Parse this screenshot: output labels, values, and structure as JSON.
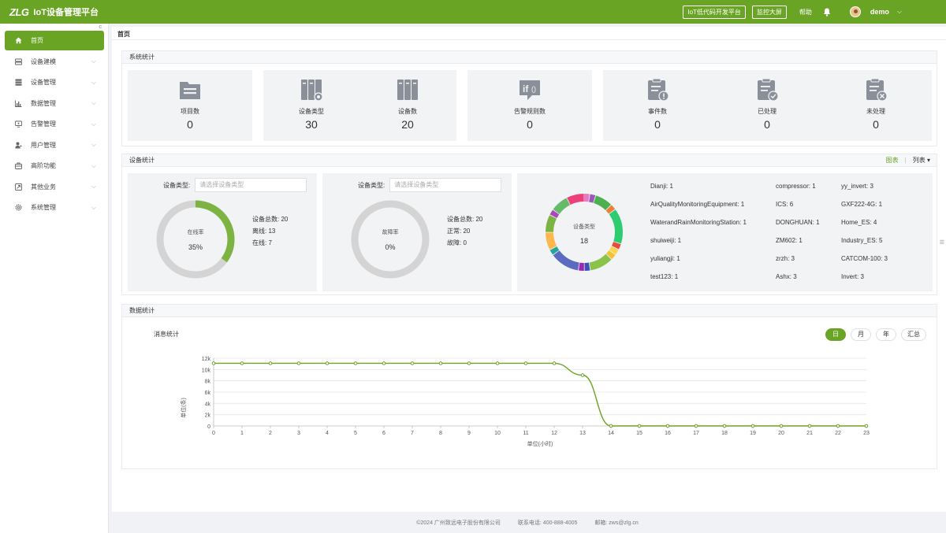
{
  "header": {
    "logo": "ZLG",
    "title": "IoT设备管理平台",
    "lowcode_label": "IoT低代码开发平台",
    "monitor_label": "监控大屏",
    "help_label": "帮助",
    "username": "demo",
    "accent": "#6aa424"
  },
  "sidebar": {
    "items": [
      {
        "label": "首页",
        "icon": "home-icon"
      },
      {
        "label": "设备建模",
        "icon": "model-icon"
      },
      {
        "label": "设备管理",
        "icon": "device-icon"
      },
      {
        "label": "数据管理",
        "icon": "bar-chart-icon"
      },
      {
        "label": "告警管理",
        "icon": "alarm-icon"
      },
      {
        "label": "用户管理",
        "icon": "user-icon"
      },
      {
        "label": "高阶功能",
        "icon": "toolbox-icon"
      },
      {
        "label": "其他业务",
        "icon": "link-icon"
      },
      {
        "label": "系统管理",
        "icon": "gear-icon"
      }
    ]
  },
  "page": {
    "title": "首页"
  },
  "system_stats": {
    "title": "系统统计",
    "items": [
      {
        "label": "项目数",
        "value": "0",
        "icon": "project-icon"
      },
      {
        "label": "设备类型",
        "value": "30",
        "icon": "device-type-icon"
      },
      {
        "label": "设备数",
        "value": "20",
        "icon": "devices-icon"
      },
      {
        "label": "告警规则数",
        "value": "0",
        "icon": "rule-icon"
      },
      {
        "label": "事件数",
        "value": "0",
        "icon": "event-icon"
      },
      {
        "label": "已处理",
        "value": "0",
        "icon": "handled-icon"
      },
      {
        "label": "未处理",
        "value": "0",
        "icon": "unhandled-icon"
      }
    ]
  },
  "device_stats": {
    "title": "设备统计",
    "view_chart": "图表",
    "view_list": "列表",
    "online_panel": {
      "filter_label": "设备类型:",
      "placeholder": "请选择设备类型",
      "gauge_label": "在线率",
      "gauge_value": "35%",
      "rate": 0.35,
      "total": "设备总数: 20",
      "offline": "离线: 13",
      "online": "在线: 7"
    },
    "fault_panel": {
      "filter_label": "设备类型:",
      "placeholder": "请选择设备类型",
      "gauge_label": "故障率",
      "gauge_value": "0%",
      "rate": 0,
      "total": "设备总数: 20",
      "normal": "正常: 20",
      "fault": "故障: 0"
    },
    "type_panel": {
      "center_label": "设备类型",
      "center_value": "18",
      "legend": [
        "Dianji:  1",
        "compressor:  1",
        "yy_invert:  3",
        "AirQualityMonitoringEquipment:  1",
        "ICS:  6",
        "GXF222-4G:  1",
        "WaterandRainMonitoringStation:  1",
        "DONGHUAN:  1",
        "Home_ES:  4",
        "shuiweiji:  1",
        "ZM602:  1",
        "Industry_ES:  5",
        "yuliangji:  1",
        "zrzh:  3",
        "CATCOM-100:  3",
        "test123:  1",
        "Ashx:  3",
        "Invert:  3"
      ],
      "ring_colors": [
        "#e879c4",
        "#9b59b6",
        "#4caf50",
        "#ef7d3b",
        "#2ecc71",
        "#e74c3c",
        "#ffd54f",
        "#f1c232",
        "#8bc34a",
        "#3f51b5",
        "#9c27b0",
        "#5c6bc0",
        "#26a69a",
        "#ffb74d",
        "#7cb342",
        "#ab47bc",
        "#66bb6a",
        "#ec407a"
      ]
    }
  },
  "data_stats": {
    "title": "数据统计",
    "chart_title": "消息统计",
    "tabs": [
      "日",
      "月",
      "年",
      "汇总"
    ],
    "active_tab": "日"
  },
  "chart_data": {
    "type": "line",
    "title": "消息统计",
    "xlabel": "单位(小时)",
    "ylabel": "单位(条)",
    "x": [
      0,
      1,
      2,
      3,
      4,
      5,
      6,
      7,
      8,
      9,
      10,
      11,
      12,
      13,
      14,
      15,
      16,
      17,
      18,
      19,
      20,
      21,
      22,
      23
    ],
    "y_ticks": [
      "0",
      "2k",
      "4k",
      "6k",
      "8k",
      "10k",
      "12k"
    ],
    "ylim": [
      0,
      12000
    ],
    "series": [
      {
        "values": [
          11100,
          11100,
          11100,
          11100,
          11100,
          11100,
          11100,
          11100,
          11100,
          11100,
          11100,
          11100,
          11100,
          9000,
          0,
          0,
          0,
          0,
          0,
          0,
          0,
          0,
          0,
          0
        ],
        "color": "#6aa424"
      }
    ]
  },
  "footer": {
    "copyright": "©2024 广州致远电子股份有限公司",
    "phone": "联系电话: 400-888-4005",
    "email": "邮箱: zws@zlg.cn"
  }
}
